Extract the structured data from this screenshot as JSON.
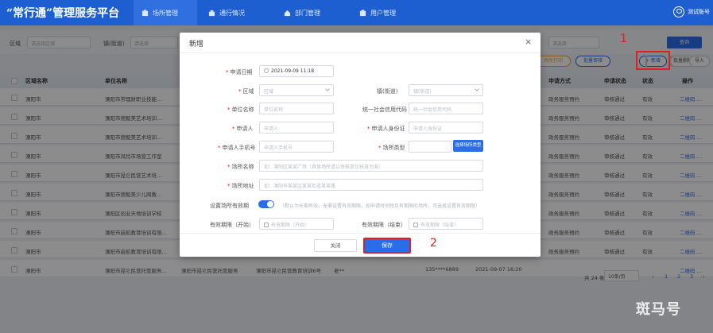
{
  "app": {
    "title": "“常行通”管理服务平台",
    "nav": [
      {
        "label": "场所管理",
        "icon": "building-icon"
      },
      {
        "label": "通行情况",
        "icon": "gate-icon"
      },
      {
        "label": "部门管理",
        "icon": "home-icon"
      },
      {
        "label": "用户管理",
        "icon": "users-icon"
      }
    ],
    "user": "测试账号"
  },
  "filters": {
    "region_label": "区域",
    "region_placeholder": "请选择区域",
    "town_label": "镇(街道)",
    "town_placeholder": "请选择",
    "right_placeholder": "请选择",
    "query_label": "查询"
  },
  "toolbar": {
    "print_label": "场所打印",
    "batch_label": "批量审核",
    "add_label": "+ 新增",
    "delete_label": "批量删除",
    "import_label": "导入"
  },
  "annotations": {
    "step1": "1",
    "step2": "2"
  },
  "table": {
    "headers": {
      "region": "区域名称",
      "unit": "单位名称",
      "apply": "申请方式",
      "status": "申请状态",
      "state": "状态",
      "action": "操作"
    },
    "rows": [
      {
        "region": "溧阳市",
        "unit": "溧阳市常理财职业技能…",
        "apply": "政务服务预约",
        "status": "审核通过",
        "state": "有效",
        "action": "二维码 …"
      },
      {
        "region": "溧阳市",
        "unit": "溧阳市德懿美艺术培训…",
        "apply": "政务服务预约",
        "status": "审核通过",
        "state": "有效",
        "action": "二维码 …"
      },
      {
        "region": "溧阳市",
        "unit": "溧阳市德懿美艺术培训…",
        "apply": "政务服务预约",
        "status": "审核通过",
        "state": "有效",
        "action": "二维码 …"
      },
      {
        "region": "溧阳市",
        "unit": "溧阳市风险市场营工作室",
        "apply": "政务服务预约",
        "status": "审核通过",
        "state": "有效",
        "action": "二维码 …"
      },
      {
        "region": "溧阳市",
        "unit": "溧阳市昆仑民营艺术培…",
        "apply": "政务服务预约",
        "status": "审核通过",
        "state": "有效",
        "action": "二维码 …"
      },
      {
        "region": "溧阳市",
        "unit": "溧阳市德懿美少儿网教…",
        "apply": "政务服务预约",
        "status": "审核通过",
        "state": "有效",
        "action": "二维码 …"
      },
      {
        "region": "溧阳市",
        "unit": "溧阳区创业天地培训学校",
        "apply": "政务服务预约",
        "status": "审核通过",
        "state": "有效",
        "action": "二维码 …"
      },
      {
        "region": "溧阳市",
        "unit": "溧阳市启航教育培训有限…",
        "apply": "政务服务预约",
        "status": "审核通过",
        "state": "有效",
        "action": "二维码 …"
      },
      {
        "region": "溧阳市",
        "unit": "溧阳市启航教育培训有限…",
        "apply": "政务服务预约",
        "status": "审核通过",
        "state": "有效",
        "action": "二维码 …"
      },
      {
        "region": "溧阳市",
        "unit": "溧阳市昆仑民营托管服务…",
        "apply": "",
        "status": "",
        "state": "",
        "action": "二维码 …",
        "extra1": "溧阳市昆仑民营托管服务",
        "extra2": "溧阳市昆仑民营教育培训6号",
        "extra3": "老**",
        "extra4": "135****6889",
        "extra5": "2021-09-07 16:20"
      }
    ]
  },
  "pager": {
    "total": "共 24 条",
    "size": "10条/页",
    "prev": "‹",
    "p1": "1",
    "p2": "2",
    "p3": "3",
    "next": "›"
  },
  "modal": {
    "title": "新增",
    "close": "×",
    "fields": {
      "apply_date_label": "申请日期",
      "apply_date_value": "2021-09-09 11:18",
      "region_label": "区域",
      "region_placeholder": "区域",
      "town_label": "镇(街道)",
      "town_placeholder": "镇(街道)",
      "unit_label": "单位名称",
      "unit_placeholder": "单位名称",
      "credit_label": "统一社会信用代码",
      "credit_placeholder": "统一社会信用代码",
      "applicant_label": "申请人",
      "applicant_placeholder": "申请人",
      "idcard_label": "申请人身份证",
      "idcard_placeholder": "申请人身份证",
      "phone_label": "申请人手机号",
      "phone_placeholder": "申请人手机号",
      "type_label": "场所类型",
      "type_button": "选择场所类型",
      "place_name_label": "场所名称",
      "place_name_placeholder": "如：溧阳区某某广场（具体场所请以审核单位核准为准）",
      "address_label": "场所地址",
      "address_placeholder": "如：溧阳市某某区某某街道某某路",
      "validity_label": "设置场所有效期",
      "validity_hint": "（默认为长期有效，无需设置有效期限，如申请时间短且有期限的场所，可选择设置有效期限）",
      "start_label": "有效期限（开始）",
      "start_placeholder": "有效期限（开始）",
      "end_label": "有效期限（结束）",
      "end_placeholder": "有效期限（结束）"
    },
    "cancel_label": "关闭",
    "save_label": "保存"
  },
  "watermark": "斑马号",
  "colors": {
    "primary": "#1d5fd1",
    "accent": "#2a6de8",
    "highlight": "#e02020"
  }
}
